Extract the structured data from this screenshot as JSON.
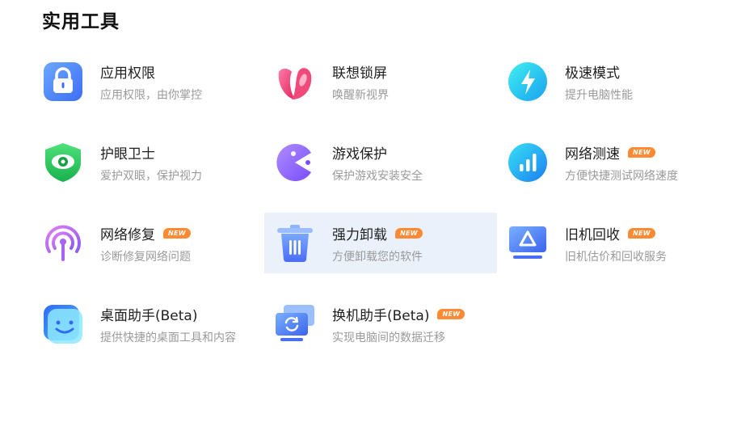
{
  "section_title": "实用工具",
  "badge_text": "NEW",
  "tools": [
    {
      "name": "应用权限",
      "desc": "应用权限，由你掌控",
      "icon": "lock-icon",
      "new": false
    },
    {
      "name": "联想锁屏",
      "desc": "唤醒新视界",
      "icon": "lenovo-lockscreen-icon",
      "new": false
    },
    {
      "name": "极速模式",
      "desc": "提升电脑性能",
      "icon": "lightning-icon",
      "new": false
    },
    {
      "name": "护眼卫士",
      "desc": "爱护双眼，保护视力",
      "icon": "eye-shield-icon",
      "new": false
    },
    {
      "name": "游戏保护",
      "desc": "保护游戏安装安全",
      "icon": "game-pacman-icon",
      "new": false
    },
    {
      "name": "网络测速",
      "desc": "方便快捷测试网络速度",
      "icon": "speed-bars-icon",
      "new": true
    },
    {
      "name": "网络修复",
      "desc": "诊断修复网络问题",
      "icon": "signal-repair-icon",
      "new": true
    },
    {
      "name": "强力卸载",
      "desc": "方便卸载您的软件",
      "icon": "trash-icon",
      "new": true
    },
    {
      "name": "旧机回收",
      "desc": "旧机估价和回收服务",
      "icon": "recycle-icon",
      "new": true
    },
    {
      "name": "桌面助手(Beta)",
      "desc": "提供快捷的桌面工具和内容",
      "icon": "smiley-icon",
      "new": false
    },
    {
      "name": "换机助手(Beta)",
      "desc": "实现电脑间的数据迁移",
      "icon": "migrate-icon",
      "new": true
    }
  ],
  "colors": {
    "active_bg": "#ebf1fb",
    "badge": "#ff8a33",
    "desc_text": "#9a9a9a"
  }
}
